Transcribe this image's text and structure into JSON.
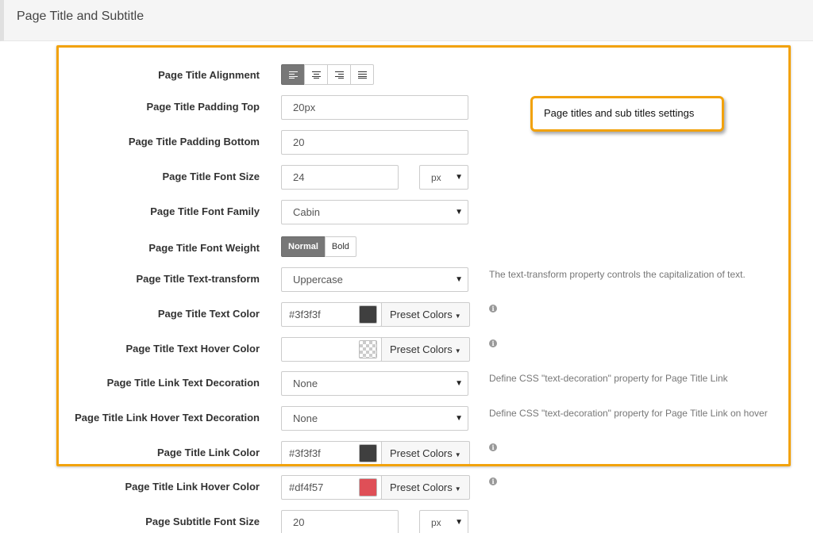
{
  "section": {
    "title": "Page Title and Subtitle"
  },
  "callout": {
    "text": "Page titles and sub titles settings"
  },
  "alignment": {
    "label": "Page Title Alignment",
    "options": [
      "align-left-icon",
      "align-center-icon",
      "align-right-icon",
      "align-justify-icon"
    ],
    "selected": "left"
  },
  "padding_top": {
    "label": "Page Title Padding Top",
    "value": "20px"
  },
  "padding_bottom": {
    "label": "Page Title Padding Bottom",
    "value": "20"
  },
  "font_size": {
    "label": "Page Title Font Size",
    "value": "24",
    "unit": "px"
  },
  "font_family": {
    "label": "Page Title Font Family",
    "value": "Cabin"
  },
  "font_weight": {
    "label": "Page Title Font Weight",
    "options": [
      "Normal",
      "Bold"
    ],
    "selected": "Normal"
  },
  "text_transform": {
    "label": "Page Title Text-transform",
    "value": "Uppercase",
    "help": "The text-transform property controls the capitalization of text."
  },
  "text_color": {
    "label": "Page Title Text Color",
    "value": "#3f3f3f",
    "swatch": "#3f3f3f",
    "preset": "Preset Colors"
  },
  "text_hover_color": {
    "label": "Page Title Text Hover Color",
    "value": "",
    "preset": "Preset Colors"
  },
  "link_text_decoration": {
    "label": "Page Title Link Text Decoration",
    "value": "None",
    "help": "Define CSS \"text-decoration\" property for Page Title Link"
  },
  "link_hover_text_decoration": {
    "label": "Page Title Link Hover Text Decoration",
    "value": "None",
    "help": "Define CSS \"text-decoration\" property for Page Title Link on hover"
  },
  "link_color": {
    "label": "Page Title Link Color",
    "value": "#3f3f3f",
    "swatch": "#3f3f3f",
    "preset": "Preset Colors"
  },
  "link_hover_color": {
    "label": "Page Title Link Hover Color",
    "value": "#df4f57",
    "swatch": "#df4f57",
    "preset": "Preset Colors"
  },
  "subtitle_font_size": {
    "label": "Page Subtitle Font Size",
    "value": "20",
    "unit": "px"
  },
  "colors": {
    "highlight": "#f2a20c",
    "active_button": "#777777"
  }
}
